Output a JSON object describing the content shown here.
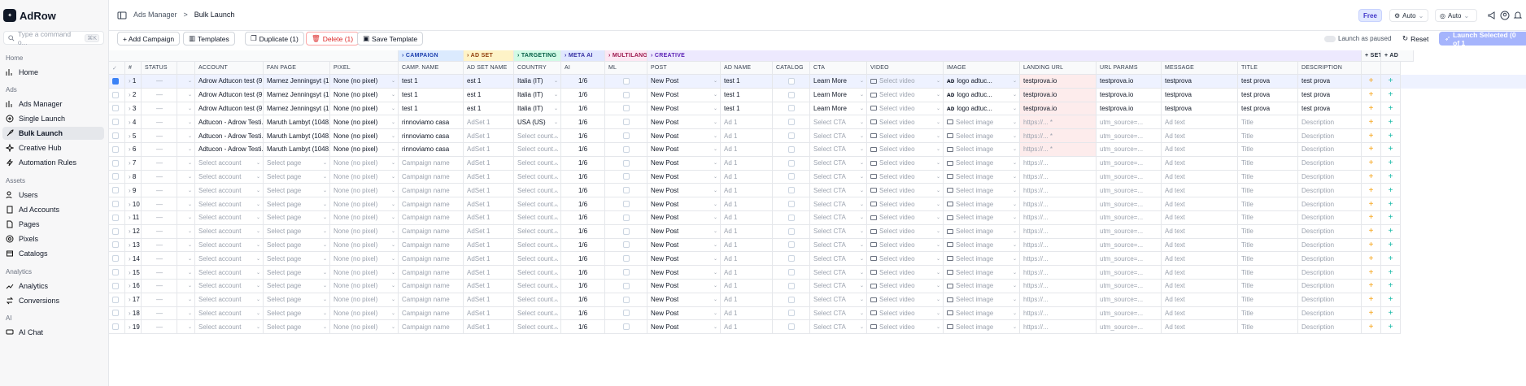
{
  "brand": {
    "name": "AdRow",
    "mark": "✦"
  },
  "command": {
    "placeholder": "Type a command o...",
    "kbd": "⌘K"
  },
  "sections": {
    "home": "Home",
    "ads": "Ads",
    "assets": "Assets",
    "analytics": "Analytics",
    "ai": "AI"
  },
  "nav": {
    "home": "Home",
    "ads_manager": "Ads Manager",
    "single_launch": "Single Launch",
    "bulk_launch": "Bulk Launch",
    "creative_hub": "Creative Hub",
    "automation_rules": "Automation Rules",
    "users": "Users",
    "ad_accounts": "Ad Accounts",
    "pages": "Pages",
    "pixels": "Pixels",
    "catalogs": "Catalogs",
    "analytics": "Analytics",
    "conversions": "Conversions",
    "ai_chat": "AI Chat"
  },
  "breadcrumb": {
    "parent": "Ads Manager",
    "sep": ">",
    "current": "Bulk Launch"
  },
  "top": {
    "plan": "Free",
    "auto1": "Auto",
    "auto2": "Auto"
  },
  "toolbar": {
    "add_campaign": "+ Add Campaign",
    "templates": "Templates",
    "duplicate": "Duplicate (1)",
    "delete": "Delete (1)",
    "save_template": "Save Template",
    "launch_paused": "Launch as paused",
    "reset": "Reset",
    "launch_selected": "Launch Selected (0 of 1"
  },
  "groups": {
    "campaign": "CAMPAIGN",
    "adset": "AD SET",
    "targeting": "TARGETING",
    "meta": "META AI",
    "multi": "MULTILANGU",
    "creative": "CREATIVE",
    "set": "+ SET",
    "ad": "+ AD"
  },
  "columns": {
    "num": "#",
    "status": "STATUS",
    "account": "ACCOUNT",
    "fan_page": "FAN PAGE",
    "pixel": "PIXEL",
    "camp_name": "CAMP. NAME",
    "adset_name": "AD SET NAME",
    "country": "COUNTRY",
    "ai": "AI",
    "ml": "ML",
    "post": "POST",
    "ad_name": "AD NAME",
    "catalog": "CATALOG",
    "cta": "CTA",
    "video": "VIDEO",
    "image": "IMAGE",
    "landing": "LANDING URL",
    "params": "URL PARAMS",
    "message": "MESSAGE",
    "title": "TITLE",
    "description": "DESCRIPTION"
  },
  "rows": [
    {
      "n": "1",
      "account": "Adrow Adtucon test (9...",
      "page": "Marnez Jenningsyt (1...",
      "pixel": "None (no pixel)",
      "camp": "test 1",
      "adset": "est 1",
      "country": "Italia (IT)",
      "ai": "1/6",
      "post": "New Post",
      "adname": "test 1",
      "cta": "Learn More",
      "video": "Select video",
      "image": "logo adtuc...",
      "landing": "testprova.io",
      "params": "testprova.io",
      "message": "testprova",
      "title": "test prova",
      "desc": "test prova",
      "sel": true
    },
    {
      "n": "2",
      "account": "Adrow Adtucon test (9...",
      "page": "Marnez Jenningsyt (1...",
      "pixel": "None (no pixel)",
      "camp": "test 1",
      "adset": "est 1",
      "country": "Italia (IT)",
      "ai": "1/6",
      "post": "New Post",
      "adname": "test 1",
      "cta": "Learn More",
      "video": "Select video",
      "image": "logo adtuc...",
      "landing": "testprova.io",
      "params": "testprova.io",
      "message": "testprova",
      "title": "test prova",
      "desc": "test prova"
    },
    {
      "n": "3",
      "account": "Adrow Adtucon test (9...",
      "page": "Marnez Jenningsyt (1...",
      "pixel": "None (no pixel)",
      "camp": "test 1",
      "adset": "est 1",
      "country": "Italia (IT)",
      "ai": "1/6",
      "post": "New Post",
      "adname": "test 1",
      "cta": "Learn More",
      "video": "Select video",
      "image": "logo adtuc...",
      "landing": "testprova.io",
      "params": "testprova.io",
      "message": "testprova",
      "title": "test prova",
      "desc": "test prova"
    },
    {
      "n": "4",
      "account": "Adtucon - Adrow Testi...",
      "page": "Maruth Lambyt (1048...",
      "pixel": "None (no pixel)",
      "camp": "rinnoviamo casa",
      "adset": "AdSet 1",
      "country": "USA (US)",
      "ai": "1/6",
      "post": "New Post",
      "adname": "Ad 1",
      "cta": "Select CTA",
      "video": "Select video",
      "image": "Select image",
      "landing": "https://... *",
      "params": "utm_source=...",
      "message": "Ad text",
      "title": "Title",
      "desc": "Description",
      "ph": true
    },
    {
      "n": "5",
      "account": "Adtucon - Adrow Testi...",
      "page": "Maruth Lambyt (1048...",
      "pixel": "None (no pixel)",
      "camp": "rinnoviamo casa",
      "adset": "AdSet 1",
      "country": "Select count...",
      "ai": "1/6",
      "post": "New Post",
      "adname": "Ad 1",
      "cta": "Select CTA",
      "video": "Select video",
      "image": "Select image",
      "landing": "https://... *",
      "params": "utm_source=...",
      "message": "Ad text",
      "title": "Title",
      "desc": "Description",
      "ph": true
    },
    {
      "n": "6",
      "account": "Adtucon - Adrow Testi...",
      "page": "Maruth Lambyt (1048...",
      "pixel": "None (no pixel)",
      "camp": "rinnoviamo casa",
      "adset": "AdSet 1",
      "country": "Select count...",
      "ai": "1/6",
      "post": "New Post",
      "adname": "Ad 1",
      "cta": "Select CTA",
      "video": "Select video",
      "image": "Select image",
      "landing": "https://... *",
      "params": "utm_source=...",
      "message": "Ad text",
      "title": "Title",
      "desc": "Description",
      "ph": true
    },
    {
      "n": "7",
      "account": "Select account",
      "page": "Select page",
      "pixel": "None (no pixel)",
      "camp": "Campaign name",
      "adset": "AdSet 1",
      "country": "Select count...",
      "ai": "1/6",
      "post": "New Post",
      "adname": "Ad 1",
      "cta": "Select CTA",
      "video": "Select video",
      "image": "Select image",
      "landing": "https://...",
      "params": "utm_source=...",
      "message": "Ad text",
      "title": "Title",
      "desc": "Description",
      "empty": true
    },
    {
      "n": "8",
      "account": "Select account",
      "page": "Select page",
      "pixel": "None (no pixel)",
      "camp": "Campaign name",
      "adset": "AdSet 1",
      "country": "Select count...",
      "ai": "1/6",
      "post": "New Post",
      "adname": "Ad 1",
      "cta": "Select CTA",
      "video": "Select video",
      "image": "Select image",
      "landing": "https://...",
      "params": "utm_source=...",
      "message": "Ad text",
      "title": "Title",
      "desc": "Description",
      "empty": true
    },
    {
      "n": "9",
      "account": "Select account",
      "page": "Select page",
      "pixel": "None (no pixel)",
      "camp": "Campaign name",
      "adset": "AdSet 1",
      "country": "Select count...",
      "ai": "1/6",
      "post": "New Post",
      "adname": "Ad 1",
      "cta": "Select CTA",
      "video": "Select video",
      "image": "Select image",
      "landing": "https://...",
      "params": "utm_source=...",
      "message": "Ad text",
      "title": "Title",
      "desc": "Description",
      "empty": true
    },
    {
      "n": "10",
      "account": "Select account",
      "page": "Select page",
      "pixel": "None (no pixel)",
      "camp": "Campaign name",
      "adset": "AdSet 1",
      "country": "Select count...",
      "ai": "1/6",
      "post": "New Post",
      "adname": "Ad 1",
      "cta": "Select CTA",
      "video": "Select video",
      "image": "Select image",
      "landing": "https://...",
      "params": "utm_source=...",
      "message": "Ad text",
      "title": "Title",
      "desc": "Description",
      "empty": true
    },
    {
      "n": "11",
      "account": "Select account",
      "page": "Select page",
      "pixel": "None (no pixel)",
      "camp": "Campaign name",
      "adset": "AdSet 1",
      "country": "Select count...",
      "ai": "1/6",
      "post": "New Post",
      "adname": "Ad 1",
      "cta": "Select CTA",
      "video": "Select video",
      "image": "Select image",
      "landing": "https://...",
      "params": "utm_source=...",
      "message": "Ad text",
      "title": "Title",
      "desc": "Description",
      "empty": true
    },
    {
      "n": "12",
      "account": "Select account",
      "page": "Select page",
      "pixel": "None (no pixel)",
      "camp": "Campaign name",
      "adset": "AdSet 1",
      "country": "Select count...",
      "ai": "1/6",
      "post": "New Post",
      "adname": "Ad 1",
      "cta": "Select CTA",
      "video": "Select video",
      "image": "Select image",
      "landing": "https://...",
      "params": "utm_source=...",
      "message": "Ad text",
      "title": "Title",
      "desc": "Description",
      "empty": true
    },
    {
      "n": "13",
      "account": "Select account",
      "page": "Select page",
      "pixel": "None (no pixel)",
      "camp": "Campaign name",
      "adset": "AdSet 1",
      "country": "Select count...",
      "ai": "1/6",
      "post": "New Post",
      "adname": "Ad 1",
      "cta": "Select CTA",
      "video": "Select video",
      "image": "Select image",
      "landing": "https://...",
      "params": "utm_source=...",
      "message": "Ad text",
      "title": "Title",
      "desc": "Description",
      "empty": true
    },
    {
      "n": "14",
      "account": "Select account",
      "page": "Select page",
      "pixel": "None (no pixel)",
      "camp": "Campaign name",
      "adset": "AdSet 1",
      "country": "Select count...",
      "ai": "1/6",
      "post": "New Post",
      "adname": "Ad 1",
      "cta": "Select CTA",
      "video": "Select video",
      "image": "Select image",
      "landing": "https://...",
      "params": "utm_source=...",
      "message": "Ad text",
      "title": "Title",
      "desc": "Description",
      "empty": true
    },
    {
      "n": "15",
      "account": "Select account",
      "page": "Select page",
      "pixel": "None (no pixel)",
      "camp": "Campaign name",
      "adset": "AdSet 1",
      "country": "Select count...",
      "ai": "1/6",
      "post": "New Post",
      "adname": "Ad 1",
      "cta": "Select CTA",
      "video": "Select video",
      "image": "Select image",
      "landing": "https://...",
      "params": "utm_source=...",
      "message": "Ad text",
      "title": "Title",
      "desc": "Description",
      "empty": true
    },
    {
      "n": "16",
      "account": "Select account",
      "page": "Select page",
      "pixel": "None (no pixel)",
      "camp": "Campaign name",
      "adset": "AdSet 1",
      "country": "Select count...",
      "ai": "1/6",
      "post": "New Post",
      "adname": "Ad 1",
      "cta": "Select CTA",
      "video": "Select video",
      "image": "Select image",
      "landing": "https://...",
      "params": "utm_source=...",
      "message": "Ad text",
      "title": "Title",
      "desc": "Description",
      "empty": true
    },
    {
      "n": "17",
      "account": "Select account",
      "page": "Select page",
      "pixel": "None (no pixel)",
      "camp": "Campaign name",
      "adset": "AdSet 1",
      "country": "Select count...",
      "ai": "1/6",
      "post": "New Post",
      "adname": "Ad 1",
      "cta": "Select CTA",
      "video": "Select video",
      "image": "Select image",
      "landing": "https://...",
      "params": "utm_source=...",
      "message": "Ad text",
      "title": "Title",
      "desc": "Description",
      "empty": true
    },
    {
      "n": "18",
      "account": "Select account",
      "page": "Select page",
      "pixel": "None (no pixel)",
      "camp": "Campaign name",
      "adset": "AdSet 1",
      "country": "Select count...",
      "ai": "1/6",
      "post": "New Post",
      "adname": "Ad 1",
      "cta": "Select CTA",
      "video": "Select video",
      "image": "Select image",
      "landing": "https://...",
      "params": "utm_source=...",
      "message": "Ad text",
      "title": "Title",
      "desc": "Description",
      "empty": true
    },
    {
      "n": "19",
      "account": "Select account",
      "page": "Select page",
      "pixel": "None (no pixel)",
      "camp": "Campaign name",
      "adset": "AdSet 1",
      "country": "Select count...",
      "ai": "1/6",
      "post": "New Post",
      "adname": "Ad 1",
      "cta": "Select CTA",
      "video": "Select video",
      "image": "Select image",
      "landing": "https://...",
      "params": "utm_source=...",
      "message": "Ad text",
      "title": "Title",
      "desc": "Description",
      "empty": true
    }
  ]
}
